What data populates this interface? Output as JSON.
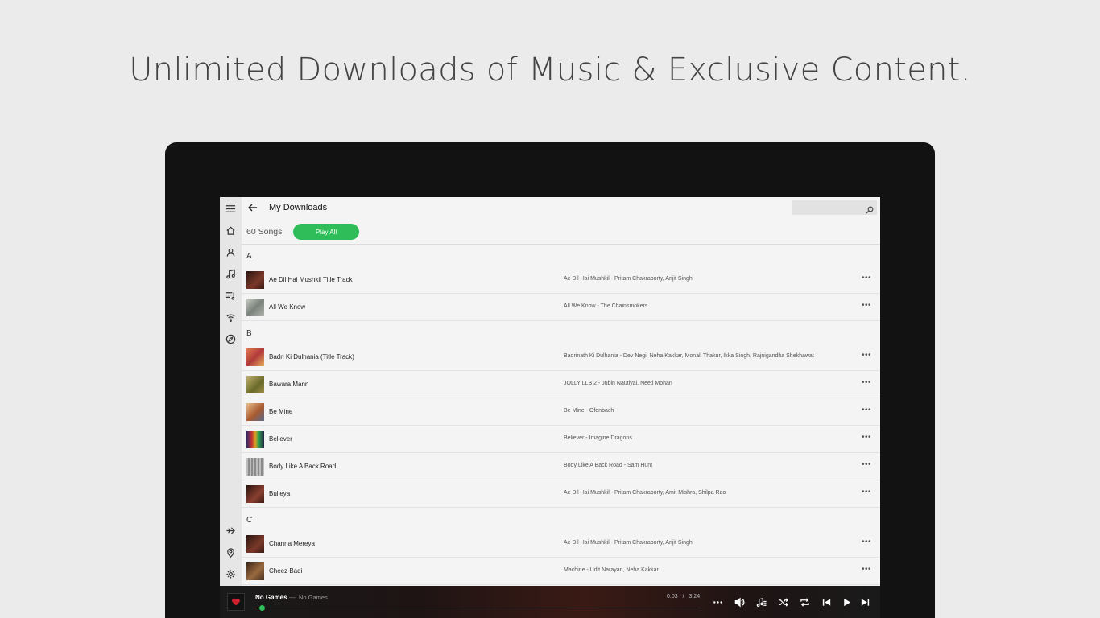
{
  "headline": "Unlimited Downloads of Music & Exclusive Content.",
  "app": {
    "title": "My Downloads",
    "search_placeholder": "",
    "count_label": "60 Songs",
    "play_all_label": "Play All"
  },
  "sidebar": {
    "top_icons": [
      "menu-icon",
      "home-icon",
      "user-icon",
      "music-note-icon",
      "playlist-icon",
      "radio-icon",
      "compass-icon"
    ],
    "bottom_icons": [
      "airplane-icon",
      "location-pin-icon",
      "gear-icon"
    ]
  },
  "sections": [
    {
      "letter": "A",
      "songs": [
        {
          "title": "Ae Dil Hai Mushkil Title Track",
          "album": "Ae Dil Hai Mushkil - Pritam Chakraborty, Arijit Singh",
          "thumb_color": "#5a2a22"
        },
        {
          "title": "All We Know",
          "album": "All We Know - The Chainsmokers",
          "thumb_color": "#9aa19a"
        }
      ]
    },
    {
      "letter": "B",
      "songs": [
        {
          "title": "Badri Ki Dulhania (Title Track)",
          "album": "Badrinath Ki Dulhania - Dev Negi, Neha Kakkar, Monali Thakur, Ikka Singh, Rajnigandha Shekhawat",
          "thumb_color": "#c0493a"
        },
        {
          "title": "Bawara Mann",
          "album": "JOLLY LLB 2 - Jubin Nautiyal, Neeti Mohan",
          "thumb_color": "#8a8a3c"
        },
        {
          "title": "Be Mine",
          "album": "Be Mine - Ofenbach",
          "thumb_color": "#b86a40"
        },
        {
          "title": "Believer",
          "album": "Believer - Imagine Dragons",
          "thumb_color": "#3a4f8a"
        },
        {
          "title": "Body Like A Back Road",
          "album": "Body Like A Back Road - Sam Hunt",
          "thumb_color": "#a8a8a8"
        },
        {
          "title": "Bulleya",
          "album": "Ae Dil Hai Mushkil - Pritam Chakraborty, Amit Mishra, Shilpa Rao",
          "thumb_color": "#5a2a22"
        }
      ]
    },
    {
      "letter": "C",
      "songs": [
        {
          "title": "Channa Mereya",
          "album": "Ae Dil Hai Mushkil - Pritam Chakraborty, Arijit Singh",
          "thumb_color": "#5a2a22"
        },
        {
          "title": "Cheez Badi",
          "album": "Machine - Udit Narayan, Neha Kakkar",
          "thumb_color": "#7a4a30"
        }
      ]
    }
  ],
  "player": {
    "title": "No Games",
    "separator": "—",
    "subtitle": "No Games",
    "elapsed": "0:03",
    "time_separator": "/",
    "duration": "3:24",
    "progress_fraction": 0.015,
    "accent": "#2ebd59",
    "controls": [
      "more-icon",
      "volume-icon",
      "queue-icon",
      "shuffle-icon",
      "repeat-icon",
      "previous-icon",
      "play-icon",
      "next-icon"
    ]
  }
}
